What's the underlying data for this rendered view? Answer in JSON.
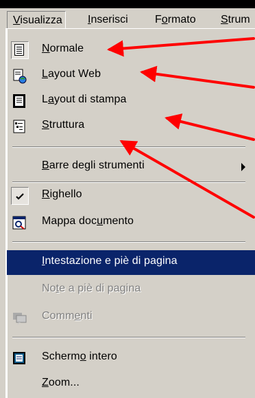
{
  "menubar": {
    "items": [
      {
        "pre": "",
        "key": "V",
        "post": "isualizza"
      },
      {
        "pre": "",
        "key": "I",
        "post": "nserisci"
      },
      {
        "pre": "F",
        "key": "o",
        "post": "rmato"
      },
      {
        "pre": "",
        "key": "S",
        "post": "trum"
      }
    ]
  },
  "menu": {
    "normale": {
      "key": "N",
      "post": "ormale"
    },
    "layout_web": {
      "key": "L",
      "post": "ayout Web"
    },
    "layout_stampa": {
      "pre": "L",
      "key": "a",
      "post": "yout di stampa"
    },
    "struttura": {
      "key": "S",
      "post": "truttura"
    },
    "barre": {
      "key": "B",
      "post": "arre degli strumenti"
    },
    "righello": {
      "key": "R",
      "post": "ighello"
    },
    "mappa": {
      "pre": "Mappa doc",
      "key": "u",
      "post": "mento"
    },
    "intestazione": {
      "pre": "",
      "key": "I",
      "post": "ntestazione e piè di pagina"
    },
    "note": {
      "pre": "No",
      "key": "t",
      "post": "e a piè di pagina"
    },
    "commenti": {
      "pre": "Comm",
      "key": "e",
      "post": "nti"
    },
    "schermo": {
      "pre": "Scherm",
      "key": "o",
      "post": " intero"
    },
    "zoom": {
      "key": "Z",
      "post": "oom..."
    }
  },
  "annotation": {
    "arrow_color": "#ff0000"
  },
  "colors": {
    "highlight": "#0a246a",
    "menu_bg": "#d4d0c8"
  }
}
